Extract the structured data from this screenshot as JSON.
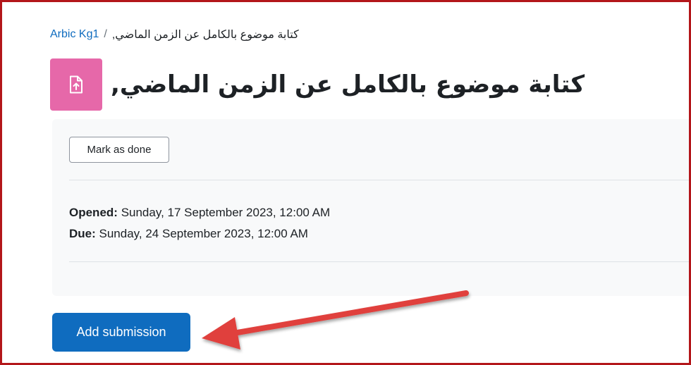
{
  "breadcrumb": {
    "course": "Arbic Kg1",
    "separator": "/",
    "current": "كتابة موضوع بالكامل عن الزمن الماضي,"
  },
  "page": {
    "title": "كتابة موضوع بالكامل عن الزمن الماضي,",
    "activity_icon": "assignment-upload-icon",
    "activity_icon_color": "#e668a9"
  },
  "completion": {
    "mark_as_done_label": "Mark as done"
  },
  "dates": {
    "opened_label": "Opened:",
    "opened_value": "Sunday, 17 September 2023, 12:00 AM",
    "due_label": "Due:",
    "due_value": "Sunday, 24 September 2023, 12:00 AM"
  },
  "actions": {
    "add_submission_label": "Add submission",
    "primary_color": "#0f6cbf"
  },
  "annotation": {
    "arrow_color": "#e0403c",
    "frame_color": "#b3161a"
  }
}
